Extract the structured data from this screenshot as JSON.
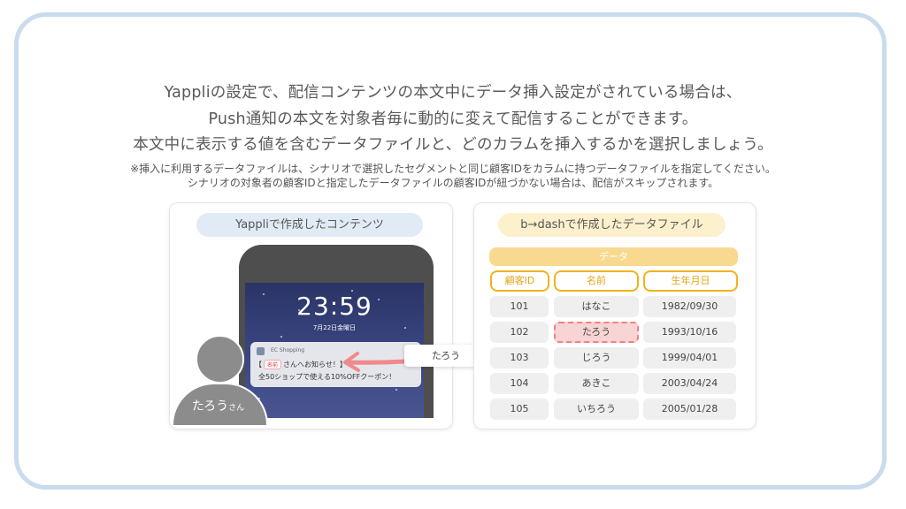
{
  "heading": {
    "line1": "Yappliの設定で、配信コンテンツの本文中にデータ挿入設定がされている場合は、",
    "line2": "Push通知の本文を対象者毎に動的に変えて配信することができます。",
    "line3": "本文中に表示する値を含むデータファイルと、どのカラムを挿入するかを選択しましょう。"
  },
  "note": {
    "line1": "※挿入に利用するデータファイルは、シナリオで選択したセグメントと同じ顧客IDをカラムに持つデータファイルを指定してください。",
    "line2": "シナリオの対象者の顧客IDと指定したデータファイルの顧客IDが紐づかない場合は、配信がスキップされます。"
  },
  "left_panel": {
    "title": "Yappliで作成したコンテンツ",
    "lock_time": "23:59",
    "lock_date": "7月22日金曜日",
    "app_name": "EC Shopping",
    "name_tag": "名前",
    "message_line1_prefix": "【",
    "message_line1_suffix": "さんへお知らせ！】",
    "message_line2": "全50ショップで使える10%OFFクーポン！",
    "person_name": "たろう",
    "person_suffix": "さん",
    "callout_value": "たろう"
  },
  "right_panel": {
    "title": "b→dashで作成したデータファイル",
    "data_label": "データ",
    "columns": [
      "顧客ID",
      "名前",
      "生年月日"
    ],
    "rows": [
      [
        "101",
        "はなこ",
        "1982/09/30"
      ],
      [
        "102",
        "たろう",
        "1993/10/16"
      ],
      [
        "103",
        "じろう",
        "1999/04/01"
      ],
      [
        "104",
        "あきこ",
        "2003/04/24"
      ],
      [
        "105",
        "いちろう",
        "2005/01/28"
      ]
    ]
  },
  "colors": {
    "frame_border": "#c9dced",
    "left_pill": "#e1ebf5",
    "right_pill": "#fdf0cc",
    "accent_yellow": "#f2b21c",
    "highlight_red": "#ef8282"
  }
}
